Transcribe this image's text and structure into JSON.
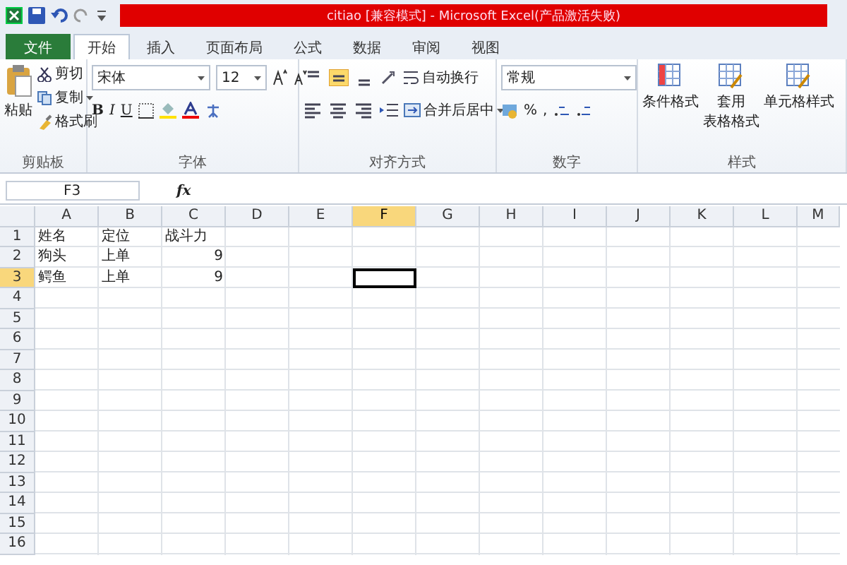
{
  "window": {
    "title": "citiao  [兼容模式] - Microsoft Excel(产品激活失败)"
  },
  "tabs": [
    {
      "label": "文件",
      "kind": "file",
      "selected": false
    },
    {
      "label": "开始",
      "kind": "tab",
      "selected": true
    },
    {
      "label": "插入",
      "kind": "tab",
      "selected": false
    },
    {
      "label": "页面布局",
      "kind": "tab",
      "selected": false
    },
    {
      "label": "公式",
      "kind": "tab",
      "selected": false
    },
    {
      "label": "数据",
      "kind": "tab",
      "selected": false
    },
    {
      "label": "审阅",
      "kind": "tab",
      "selected": false
    },
    {
      "label": "视图",
      "kind": "tab",
      "selected": false
    }
  ],
  "ribbon": {
    "clipboard": {
      "paste": "粘贴",
      "cut": "剪切",
      "copy": "复制",
      "format_painter": "格式刷",
      "label": "剪贴板"
    },
    "font": {
      "font_name": "宋体",
      "font_size": "12",
      "bold": "B",
      "italic": "I",
      "underline": "U",
      "label": "字体"
    },
    "alignment": {
      "wrap": "自动换行",
      "merge": "合并后居中",
      "label": "对齐方式"
    },
    "number": {
      "format": "常规",
      "percent": "%",
      "comma": ",",
      "label": "数字"
    },
    "styles": {
      "conditional": "条件格式",
      "table_line1": "套用",
      "table_line2": "表格格式",
      "cell_styles": "单元格样式",
      "label": "样式"
    }
  },
  "formula_bar": {
    "name_box": "F3",
    "fx": "fx"
  },
  "sheet": {
    "columns": [
      {
        "label": "A",
        "selected": false
      },
      {
        "label": "B",
        "selected": false
      },
      {
        "label": "C",
        "selected": false
      },
      {
        "label": "D",
        "selected": false
      },
      {
        "label": "E",
        "selected": false
      },
      {
        "label": "F",
        "selected": true
      },
      {
        "label": "G",
        "selected": false
      },
      {
        "label": "H",
        "selected": false
      },
      {
        "label": "I",
        "selected": false
      },
      {
        "label": "J",
        "selected": false
      },
      {
        "label": "K",
        "selected": false
      },
      {
        "label": "L",
        "selected": false
      },
      {
        "label": "M",
        "selected": false
      }
    ],
    "rows": [
      {
        "header": "1",
        "selected": false,
        "cells": [
          {
            "text": "姓名",
            "kind": "text"
          },
          {
            "text": "定位",
            "kind": "text"
          },
          {
            "text": "战斗力",
            "kind": "text"
          }
        ]
      },
      {
        "header": "2",
        "selected": false,
        "cells": [
          {
            "text": "狗头",
            "kind": "text"
          },
          {
            "text": "上单",
            "kind": "text"
          },
          {
            "text": "9",
            "kind": "number"
          }
        ]
      },
      {
        "header": "3",
        "selected": true,
        "cells": [
          {
            "text": "鳄鱼",
            "kind": "text"
          },
          {
            "text": "上单",
            "kind": "text"
          },
          {
            "text": "9",
            "kind": "number"
          }
        ]
      },
      {
        "header": "4",
        "selected": false
      },
      {
        "header": "5",
        "selected": false
      },
      {
        "header": "6",
        "selected": false
      },
      {
        "header": "7",
        "selected": false
      },
      {
        "header": "8",
        "selected": false
      },
      {
        "header": "9",
        "selected": false
      },
      {
        "header": "10",
        "selected": false
      },
      {
        "header": "11",
        "selected": false
      },
      {
        "header": "12",
        "selected": false
      },
      {
        "header": "13",
        "selected": false
      },
      {
        "header": "14",
        "selected": false
      },
      {
        "header": "15",
        "selected": false
      },
      {
        "header": "16",
        "selected": false
      }
    ]
  }
}
